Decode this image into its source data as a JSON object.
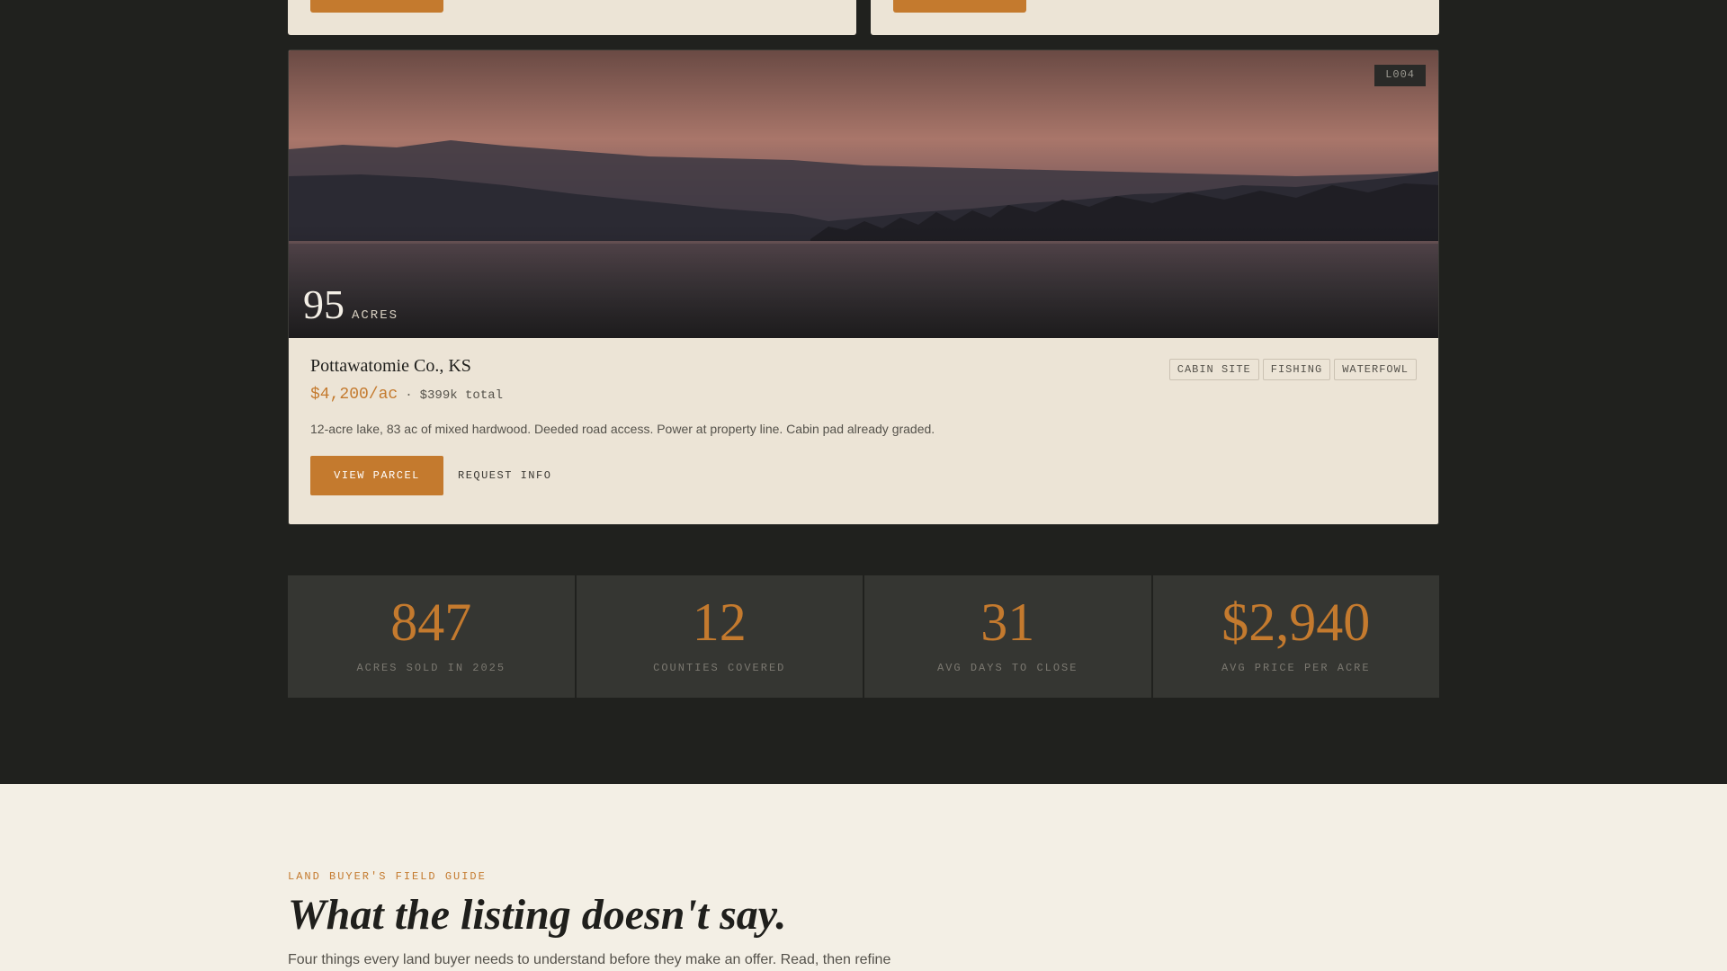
{
  "listing": {
    "lot": "L004",
    "acres": "95",
    "acres_unit": "ACRES",
    "county": "Pottawatomie Co., KS",
    "price_per_acre": "$4,200/ac",
    "separator": "·",
    "total": "$399k total",
    "description": "12-acre lake, 83 ac of mixed hardwood. Deeded road access. Power at property line. Cabin pad already graded.",
    "view_label": "VIEW PARCEL",
    "request_label": "REQUEST INFO",
    "tags": [
      "CABIN SITE",
      "FISHING",
      "WATERFOWL"
    ]
  },
  "stats": [
    {
      "value": "847",
      "label": "ACRES SOLD IN 2025"
    },
    {
      "value": "12",
      "label": "COUNTIES COVERED"
    },
    {
      "value": "31",
      "label": "AVG DAYS TO CLOSE"
    },
    {
      "value": "$2,940",
      "label": "AVG PRICE PER ACRE"
    }
  ],
  "guide": {
    "eyebrow": "LAND BUYER'S FIELD GUIDE",
    "title": "What the listing doesn't say.",
    "subtitle": "Four things every land buyer needs to understand before they make an offer. Read, then refine"
  },
  "colors": {
    "accent": "#c47a2e",
    "page_bg": "#20211e",
    "card_bg": "#ece4d6",
    "stat_bg": "#353632"
  }
}
